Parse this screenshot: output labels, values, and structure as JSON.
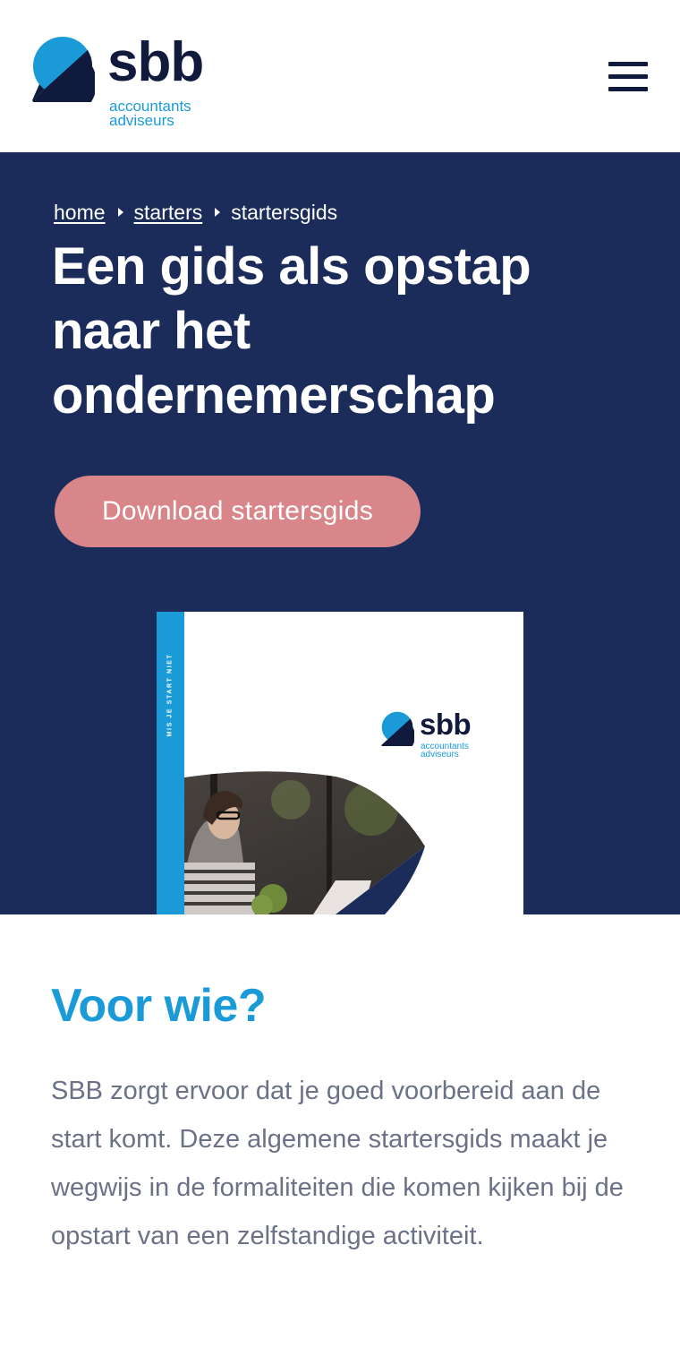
{
  "header": {
    "logo": {
      "wordmark": "sbb",
      "tagline_line1": "accountants",
      "tagline_line2": "adviseurs"
    },
    "menu_icon": "hamburger-menu-icon"
  },
  "hero": {
    "breadcrumb": [
      {
        "label": "home"
      },
      {
        "label": "starters"
      },
      {
        "label": "startersgids"
      }
    ],
    "title": "Een gids als opstap naar het ondernemerschap",
    "cta_label": "Download startersgids",
    "cover": {
      "spine_text": "MIS JE START NIET",
      "logo_wordmark": "sbb",
      "logo_tagline_line1": "accountants",
      "logo_tagline_line2": "adviseurs"
    }
  },
  "section": {
    "heading": "Voor wie?",
    "body": "SBB zorgt ervoor dat je goed voorbereid aan de start komt. Deze algemene startersgids maakt je wegwijs in de formaliteiten die komen kijken bij de opstart van een zelfstandige activiteit."
  },
  "colors": {
    "navy": "#1b2c5a",
    "dark_navy": "#0f1a3c",
    "brand_blue": "#1a9bd7",
    "cta_pink": "#d8868a",
    "body_text": "#6b7287"
  }
}
